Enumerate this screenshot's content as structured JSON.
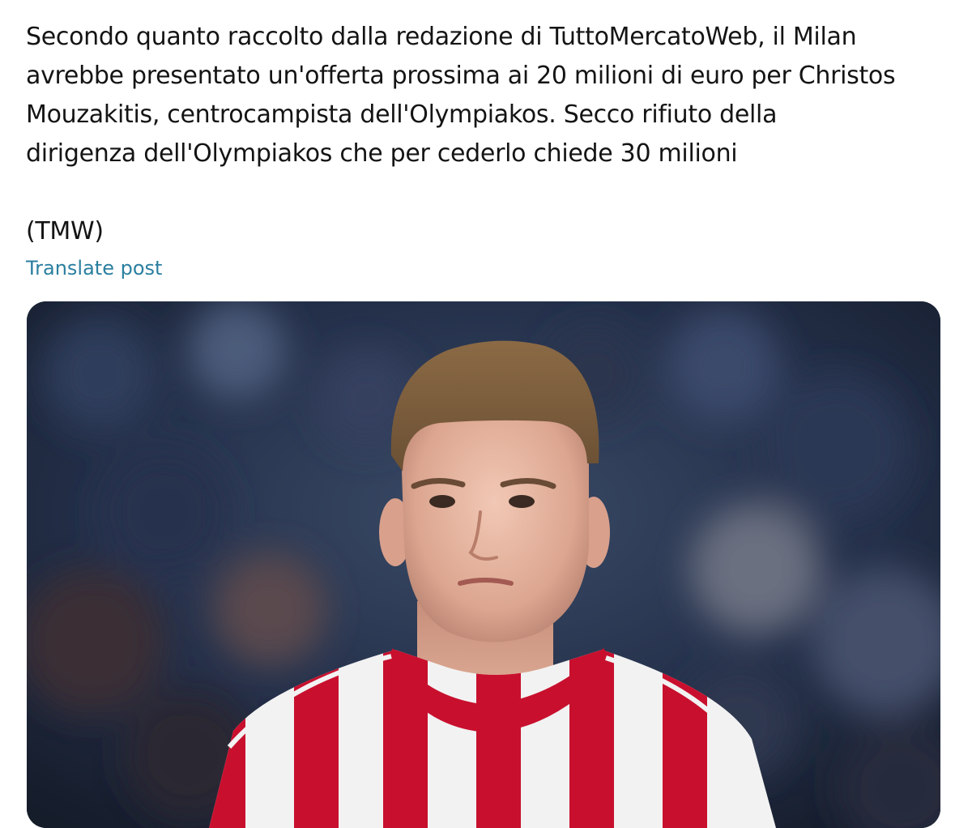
{
  "tweet": {
    "text_lines": [
      "Secondo quanto raccolto dalla redazione di TuttoMercatoWeb, il Milan",
      "avrebbe presentato un'offerta prossima ai 20 milioni di euro per Christos",
      "Mouzakitis, centrocampista dell'Olympiakos. Secco rifiuto della",
      "dirigenza dell'Olympiakos che per cederlo chiede 30 milioni"
    ],
    "source": "(TMW)",
    "translate_label": "Translate post"
  },
  "colors": {
    "text": "#141414",
    "link": "#2b7fa0",
    "jersey_red": "#c8102e",
    "jersey_white": "#f2f2f2"
  },
  "media": {
    "icon": "player-photo"
  }
}
